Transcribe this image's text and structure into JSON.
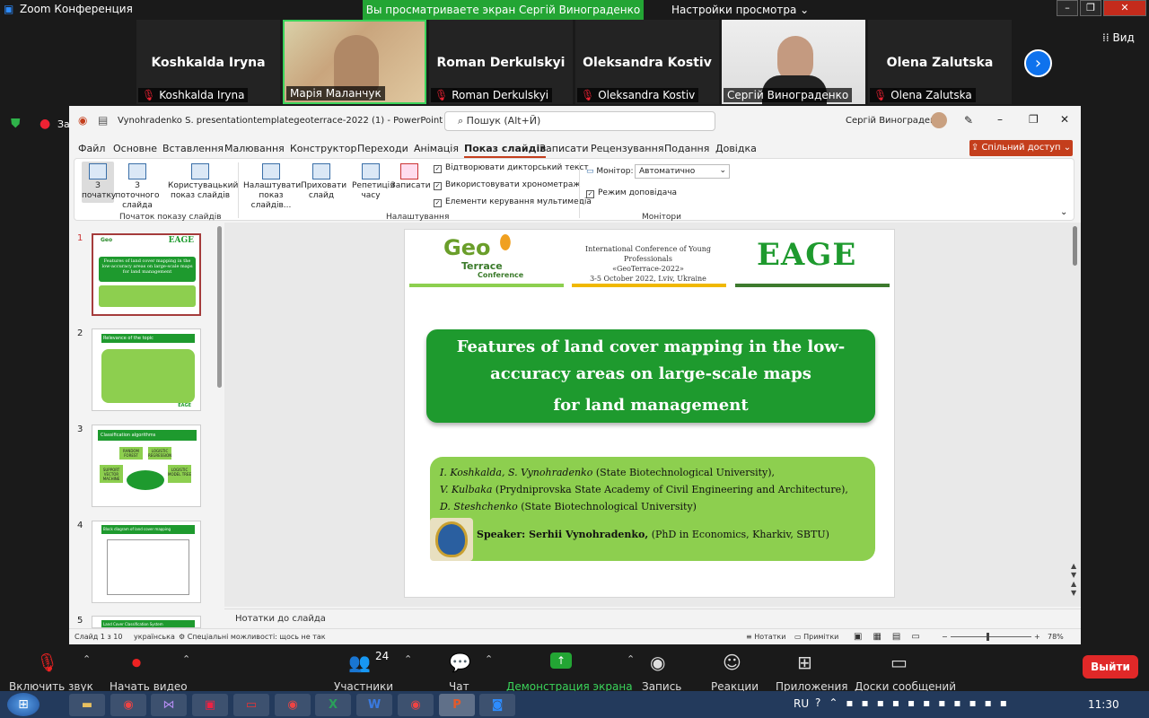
{
  "zoom": {
    "window_title": "Zoom Конференция",
    "share_banner": "Вы просматриваете экран Сергій Винограденко",
    "view_settings": "Настройки просмотра",
    "view_button": "Вид",
    "participants": [
      {
        "name": "Koshkalda Iryna",
        "label": "Koshkalda Iryna",
        "muted": true,
        "video": false
      },
      {
        "name": "",
        "label": "Марія Маланчук",
        "muted": false,
        "video": true
      },
      {
        "name": "Roman Derkulskyi",
        "label": "Roman Derkulskyi",
        "muted": true,
        "video": false
      },
      {
        "name": "Oleksandra Kostiv",
        "label": "Oleksandra Kostiv",
        "muted": true,
        "video": false
      },
      {
        "name": "",
        "label": "Сергій Винограденко",
        "muted": false,
        "video": true
      },
      {
        "name": "Olena Zalutska",
        "label": "Olena Zalutska",
        "muted": true,
        "video": false
      }
    ],
    "side_label": "За",
    "bottom": {
      "unmute": "Включить звук",
      "video": "Начать видео",
      "participants": "Участники",
      "participants_count": "24",
      "chat": "Чат",
      "share": "Демонстрация экрана",
      "record": "Запись",
      "reactions": "Реакции",
      "apps": "Приложения",
      "boards": "Доски сообщений",
      "leave": "Выйти"
    }
  },
  "ppt": {
    "title": "Vynohradenko S. presentationtemplategeoterrace-2022 (1)  -  PowerPoint",
    "search_placeholder": "Пошук (Alt+Й)",
    "user": "Сергій Винограденко",
    "menu": [
      "Файл",
      "Основне",
      "Вставлення",
      "Малювання",
      "Конструктор",
      "Переходи",
      "Анімація",
      "Показ слайдів",
      "Записати",
      "Рецензування",
      "Подання",
      "Довідка"
    ],
    "active_menu": "Показ слайдів",
    "share_button": "Спільний доступ",
    "ribbon": {
      "from_start": "З початку",
      "from_current": "З поточного слайда",
      "custom_show": "Користувацький показ слайдів",
      "setup": "Налаштувати показ слайдів...",
      "hide": "Приховати слайд",
      "rehearse": "Репетиція часу",
      "record": "Записати",
      "play_narration": "Відтворювати дикторський текст",
      "use_timings": "Використовувати хронометраж",
      "media_controls": "Елементи керування мультимедіа",
      "monitor_label": "Монітор:",
      "monitor_value": "Автоматично",
      "presenter_view": "Режим доповідача",
      "group_start": "Початок показу слайдів",
      "group_setup": "Налаштування",
      "group_monitors": "Монітори"
    },
    "slide_numbers": [
      "1",
      "2",
      "3",
      "4",
      "5"
    ],
    "thumb_text": {
      "t1_logo": "EAGE",
      "t1_title": "Features of land cover mapping in the low-accuracy areas on large-scale maps for land management",
      "t2_head": "Relevance of the topic",
      "t3_head": "Classification algorithms",
      "t3_a": "RANDOM FOREST",
      "t3_b": "LOGISTIC REGRESSION",
      "t3_c": "SUPPORT VECTOR MACHINE",
      "t3_d": "LOGISTIC MODEL TREE",
      "t4_head": "Block diagram of land cover mapping",
      "t5_head": "Land Cover Classification System",
      "eage_small": "EAGE"
    },
    "slide": {
      "logo_geo": "Geo",
      "logo_terrace": "Terrace",
      "logo_conf": "Conference",
      "conf_line1": "International Conference of Young Professionals",
      "conf_line2": "«GeoTerrace-2022»",
      "conf_line3": "3-5 October 2022, Lviv, Ukraine",
      "eage": "EAGE",
      "title1": "Features of land cover mapping in the low-",
      "title2": "accuracy areas on large-scale maps",
      "title3": "for land management",
      "auth1_names": "I. Koshkalda, S. Vynohradenko",
      "auth1_aff": " (State Biotechnological University),",
      "auth2_names": "V. Kulbaka",
      "auth2_aff": " (Prydniprovska State Academy of Civil Engineering and Architecture),",
      "auth3_names": "D. Steshchenko",
      "auth3_aff": " (State Biotechnological University)",
      "speaker_label": "Speaker: Serhii Vynohradenko,",
      "speaker_aff": " (PhD in Economics, Kharkiv, SBTU)"
    },
    "notes_placeholder": "Нотатки до слайда",
    "status": {
      "slide": "Слайд 1 з 10",
      "lang": "українська",
      "access": "Спеціальні можливості: щось не так",
      "notes": "Нотатки",
      "comments": "Примітки",
      "zoom": "78%"
    }
  },
  "taskbar": {
    "lang": "RU",
    "time": "11:30"
  },
  "colors": {
    "zoom_green": "#23a534",
    "slide_green": "#1e9a2e",
    "slide_light_green": "#8dcf4f",
    "ppt_accent": "#c43e1c",
    "leave_red": "#e02828"
  }
}
